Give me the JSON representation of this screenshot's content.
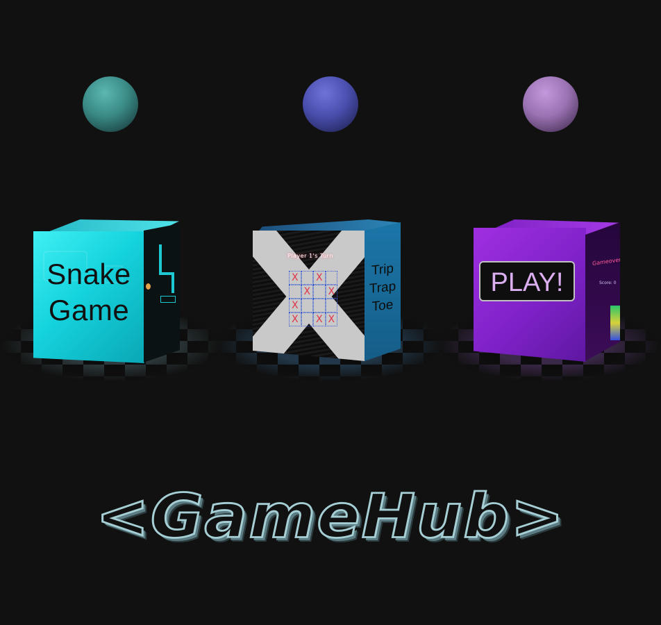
{
  "app": {
    "title": "<GameHub>",
    "accent_colors": {
      "background": "#111111",
      "teal": "#15d3dd",
      "blue": "#1b76a8",
      "purple": "#8a28d4",
      "title_outline": "#a6cfd5"
    }
  },
  "games": [
    {
      "name": "snake",
      "front_label_line1": "Snake",
      "front_label_line2": "Game",
      "orb_color": "#3a8a86"
    },
    {
      "name": "trip-trap-toe",
      "turn_text": "Player 1's Turn",
      "side_label": "Trip Trap Toe",
      "board": [
        [
          "X",
          "",
          "X",
          ""
        ],
        [
          "",
          "X",
          "",
          "X"
        ],
        [
          "X",
          "",
          "",
          ""
        ],
        [
          "X",
          "",
          "X",
          "X"
        ]
      ],
      "orb_color": "#4a4fae"
    },
    {
      "name": "play",
      "button_label": "PLAY!",
      "side_title": "Gameover!",
      "side_score": "Score: 0",
      "orb_color": "#9a73b3"
    }
  ]
}
